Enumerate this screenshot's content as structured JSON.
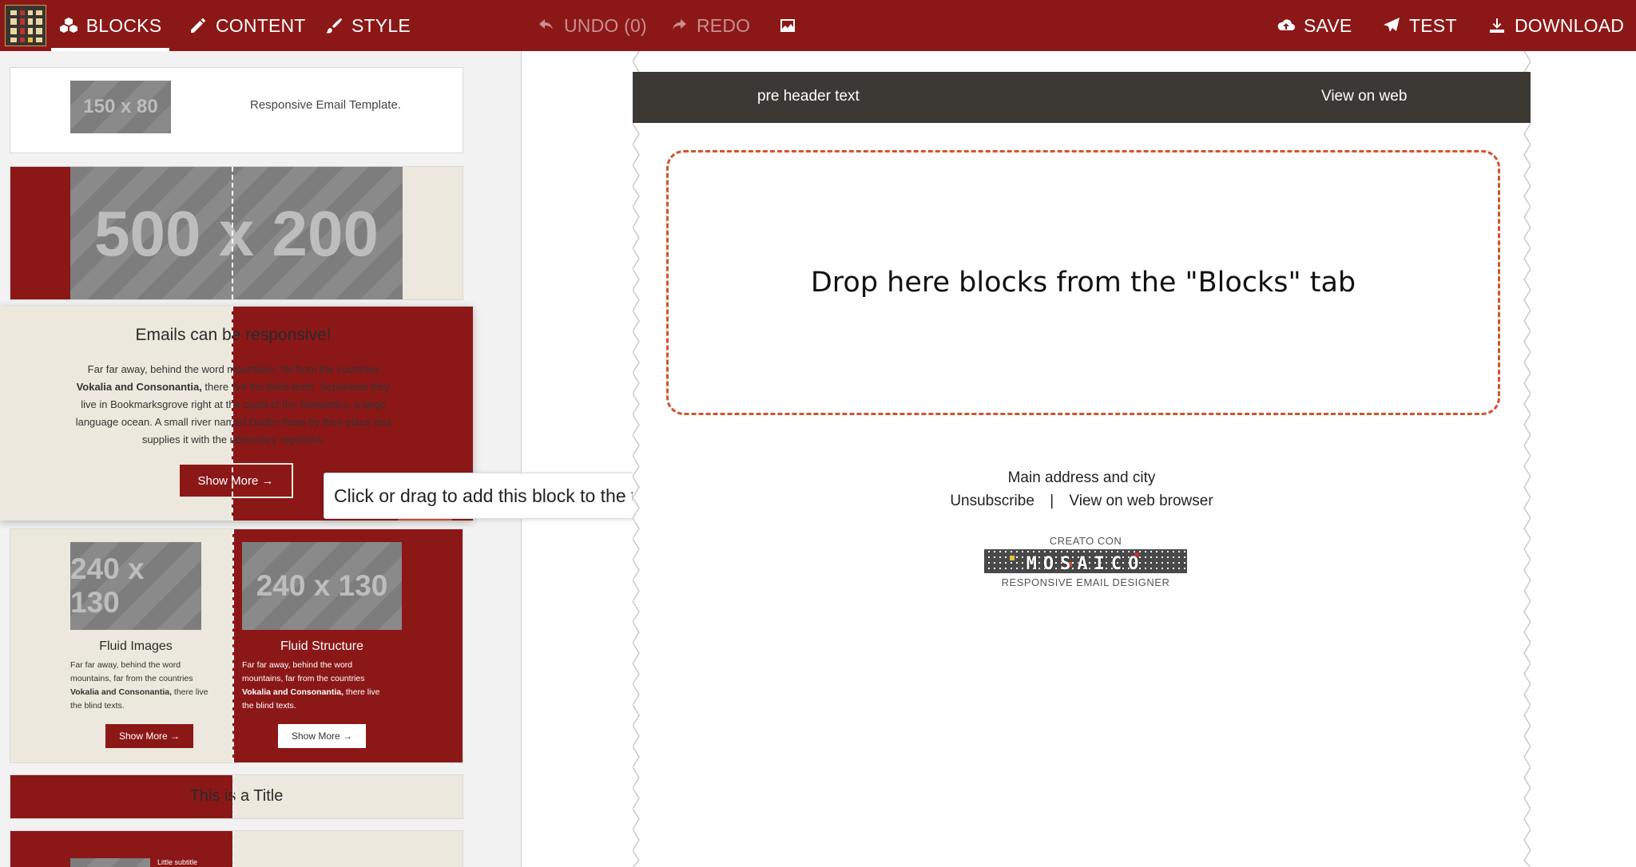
{
  "toolbar": {
    "tabs": [
      {
        "label": "BLOCKS",
        "icon": "cubes-icon",
        "active": true
      },
      {
        "label": "CONTENT",
        "icon": "pencil-icon"
      },
      {
        "label": "STYLE",
        "icon": "brush-icon"
      }
    ],
    "undo_label": "UNDO (0)",
    "redo_label": "REDO",
    "gallery_icon": "image-icon",
    "save_label": "SAVE",
    "test_label": "TEST",
    "download_label": "DOWNLOAD",
    "accent": "#8b1817"
  },
  "blocks_panel": {
    "block1": {
      "logo_placeholder": "150 x 80",
      "text": "Responsive Email Template."
    },
    "block2": {
      "image_placeholder": "500 x 200"
    },
    "block3": {
      "title": "Emails can be responsive!",
      "line1": "Far far away, behind the word mountains, far from the countries",
      "line2_bold": "Vokalia and Consonantia,",
      "line2_rest": " there live the blind texts. Separated they",
      "line3": "live in Bookmarksgrove right at the coast of the Semantics, a large",
      "line4": "language ocean. A small river named Duden flows by their place and",
      "line5": "supplies it with the necessary regelialia.",
      "button": "Show More →"
    },
    "block4": {
      "left": {
        "image_placeholder": "240 x 130",
        "title": "Fluid Images",
        "line1": "Far far away, behind the word",
        "line2": "mountains, far from the countries",
        "line3_bold": "Vokalia and Consonantia,",
        "line3_rest": " there live",
        "line4": "the blind texts.",
        "button": "Show More →"
      },
      "right": {
        "image_placeholder": "240 x 130",
        "title": "Fluid Structure",
        "line1": "Far far away, behind the word",
        "line2": "mountains, far from the countries",
        "line3_bold": "Vokalia and Consonantia,",
        "line3_rest": " there live",
        "line4": "the blind texts.",
        "button": "Show More →"
      }
    },
    "block5": {
      "title": "This is a Title"
    },
    "block6": {
      "subtitle": "Little subtitle"
    },
    "tooltip": "Click or drag to add this block to the template"
  },
  "canvas": {
    "preheader_text": "pre header text",
    "view_on_web": "View on web",
    "dropzone_text": "Drop here blocks from the \"Blocks\" tab",
    "dropzone_color": "#d4532c",
    "address": "Main address and city",
    "unsubscribe": "Unsubscribe",
    "separator": "|",
    "view_browser": "View on web browser",
    "badge_top": "CREATO CON",
    "badge_brand": "MOSAICO",
    "badge_bottom": "RESPONSIVE EMAIL DESIGNER"
  }
}
